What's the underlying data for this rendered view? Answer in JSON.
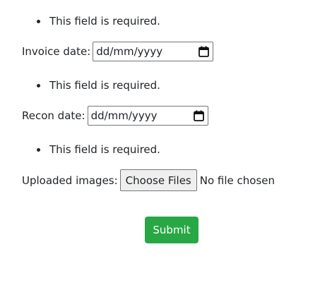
{
  "colors": {
    "submit_background": "#28a745",
    "submit_text": "#ffffff",
    "text": "#212529"
  },
  "invoice": {
    "error": "This field is required.",
    "label": "Invoice date:",
    "placeholder": "dd/mm/yyyy",
    "icon": "calendar-icon"
  },
  "recon": {
    "error": "This field is required.",
    "label": "Recon date:",
    "placeholder": "dd/mm/yyyy",
    "icon": "calendar-icon"
  },
  "images": {
    "error": "This field is required.",
    "label": "Uploaded images:",
    "button_label": "Choose Files",
    "status": "No file chosen"
  },
  "submit": {
    "label": "Submit"
  }
}
